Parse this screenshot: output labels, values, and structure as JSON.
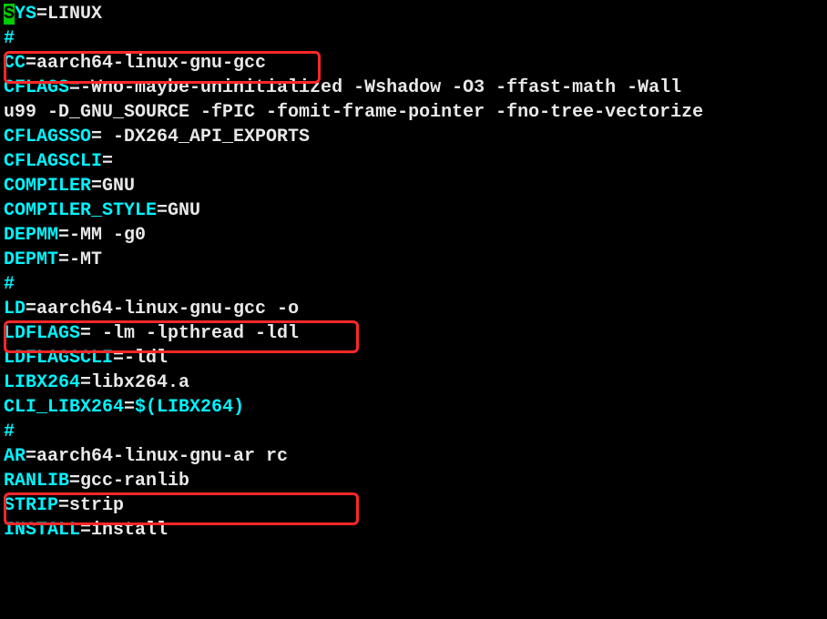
{
  "lines": [
    {
      "var": "SYS",
      "value": "=LINUX",
      "cursor": true
    },
    {
      "comment": "#"
    },
    {
      "var": "CC",
      "value": "=aarch64-linux-gnu-gcc"
    },
    {
      "var": "CFLAGS",
      "value": "=-Wno-maybe-uninitialized -Wshadow -O3 -ffast-math  -Wall"
    },
    {
      "var": "u99 -D_GNU_SOURCE -fPIC -fomit-frame-pointer -fno-tree-vectorize",
      "value": "",
      "allvalue": true
    },
    {
      "var": "CFLAGSSO",
      "value": "= -DX264_API_EXPORTS"
    },
    {
      "var": "CFLAGSCLI",
      "value": "="
    },
    {
      "var": "COMPILER",
      "value": "=GNU"
    },
    {
      "var": "COMPILER_STYLE",
      "value": "=GNU"
    },
    {
      "var": "DEPMM",
      "value": "=-MM -g0"
    },
    {
      "var": "DEPMT",
      "value": "=-MT"
    },
    {
      "comment": "#"
    },
    {
      "var": "LD",
      "value": "=aarch64-linux-gnu-gcc -o"
    },
    {
      "var": "LDFLAGS",
      "value": "= -lm -lpthread -ldl"
    },
    {
      "var": "LDFLAGSCLI",
      "value": "=-ldl"
    },
    {
      "var": "LIBX264",
      "value": "=libx264.a"
    },
    {
      "var": "CLI_LIBX264",
      "value": "=",
      "suffix_var": "$(LIBX264)"
    },
    {
      "comment": "#"
    },
    {
      "var": "AR",
      "value": "=aarch64-linux-gnu-ar rc"
    },
    {
      "var": "RANLIB",
      "value": "=gcc-ranlib"
    },
    {
      "var": "STRIP",
      "value": "=strip"
    },
    {
      "var": "INSTALL",
      "value": "=install"
    }
  ]
}
